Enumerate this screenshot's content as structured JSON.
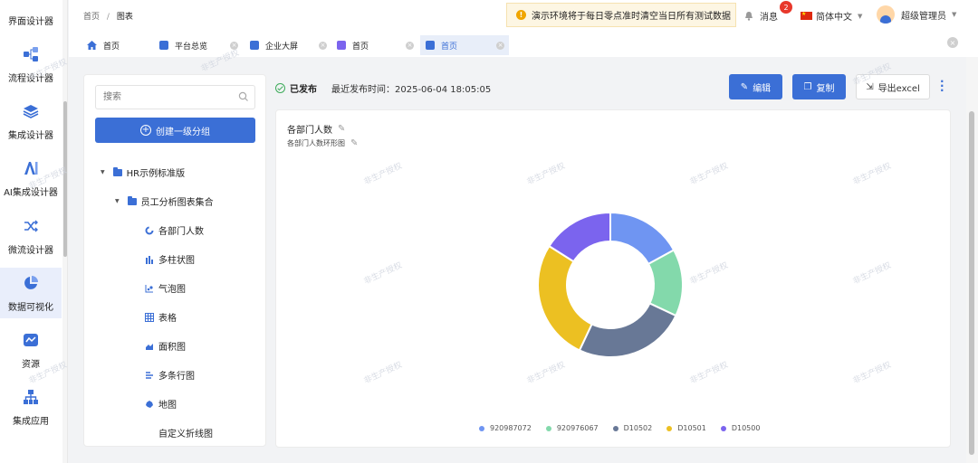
{
  "app_nav": {
    "items": [
      {
        "label": "界面设计器",
        "icon": "layout-icon"
      },
      {
        "label": "流程设计器",
        "icon": "flow-icon"
      },
      {
        "label": "集成设计器",
        "icon": "layers-icon"
      },
      {
        "label": "AI集成设计器",
        "icon": "ai-icon"
      },
      {
        "label": "微流设计器",
        "icon": "shuffle-icon"
      },
      {
        "label": "数据可视化",
        "icon": "pie-icon",
        "active": true
      },
      {
        "label": "资源",
        "icon": "resource-icon"
      },
      {
        "label": "集成应用",
        "icon": "sitemap-icon"
      }
    ]
  },
  "header": {
    "breadcrumb": {
      "home": "首页",
      "separator": "/",
      "current": "图表"
    },
    "notice": "演示环境将于每日零点准时清空当日所有测试数据",
    "messages_label": "消息",
    "messages_count": "2",
    "language": "简体中文",
    "user_name": "超级管理员"
  },
  "tabs": [
    {
      "label": "首页",
      "icon": "home-icon"
    },
    {
      "label": "平台总览",
      "icon": "grid-icon"
    },
    {
      "label": "企业大屏",
      "icon": "grid-icon"
    },
    {
      "label": "首页",
      "icon": "app-icon"
    },
    {
      "label": "首页",
      "icon": "app-icon",
      "active": true
    }
  ],
  "sidebar": {
    "search_placeholder": "搜索",
    "create_button": "创建一级分组",
    "tree": {
      "root": "HR示例标准版",
      "group": "员工分析图表集合",
      "items": [
        {
          "label": "各部门人数",
          "icon": "donut-icon"
        },
        {
          "label": "多柱状图",
          "icon": "bar-chart-icon"
        },
        {
          "label": "气泡图",
          "icon": "bubble-chart-icon"
        },
        {
          "label": "表格",
          "icon": "table-icon"
        },
        {
          "label": "面积图",
          "icon": "area-chart-icon"
        },
        {
          "label": "多条行图",
          "icon": "multi-row-icon"
        },
        {
          "label": "地图",
          "icon": "map-icon"
        },
        {
          "label": "自定义折线图",
          "icon": ""
        }
      ]
    }
  },
  "toolbar": {
    "status": "已发布",
    "last_publish": "最近发布时间：2025-06-04 18:05:05",
    "edit_label": "编辑",
    "copy_label": "复制",
    "export_label": "导出excel"
  },
  "panel": {
    "title": "各部门人数",
    "subtitle": "各部门人数环形图"
  },
  "watermark_text": "非生产授权",
  "chart_data": {
    "type": "pie",
    "variant": "donut",
    "title": "各部门人数",
    "subtitle": "各部门人数环形图",
    "legend_position": "bottom",
    "slices": [
      {
        "name": "920987072",
        "value": 17,
        "color": "#6f95f2"
      },
      {
        "name": "920976067",
        "value": 15,
        "color": "#83d9ab"
      },
      {
        "name": "D10502",
        "value": 25,
        "color": "#687896"
      },
      {
        "name": "D10501",
        "value": 27,
        "color": "#ecc022"
      },
      {
        "name": "D10500",
        "value": 16,
        "color": "#7b64ee"
      }
    ]
  }
}
